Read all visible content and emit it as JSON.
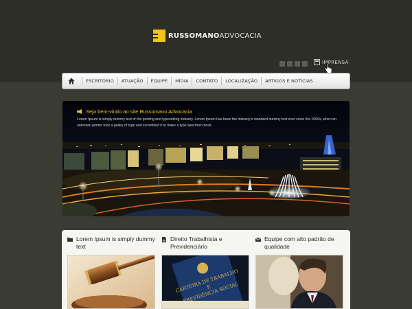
{
  "header": {
    "brand_bold": "RUSSOMANO",
    "brand_light": "ADVOCACIA",
    "social_icons": [
      "facebook-icon",
      "twitter-icon",
      "youtube-icon",
      "rss-icon"
    ],
    "imprensa_label": "IMPRENSA"
  },
  "nav": {
    "home_icon": "home-icon",
    "items": [
      "ESCRITÓRIO",
      "ATUAÇÃO",
      "EQUIPE",
      "MÍDIA",
      "CONTATO",
      "LOCALIZAÇÃO",
      "ARTIGOS E NOTÍCIAS"
    ]
  },
  "hero": {
    "title": "Seja bem-vindo ao site Russomano Advocacia",
    "text": "Lorem Ipsum is simply dummy text of the printing and typesetting industry. Lorem Ipsum has been the industry's standard dummy text ever since the 1500s, when an unknown printer took a galley of type and scrambled it to make a type specimen book."
  },
  "cards": [
    {
      "icon": "folder-icon",
      "title": "Lorem Ipsum is simply dummy text",
      "image": "gavel"
    },
    {
      "icon": "document-icon",
      "title": "Direito Trabalhista e Previdenciário",
      "image": "work-card"
    },
    {
      "icon": "envelope-icon",
      "title": "Equipe com alto padrão de qualidade",
      "image": "lawyer"
    }
  ],
  "work_card_text": {
    "line1": "CARTEIRA DE TRABALHO",
    "line2": "E",
    "line3": "PREVIDÊNCIA SOCIAL"
  },
  "colors": {
    "accent": "#f0c419",
    "header_bg": "#2d2e27",
    "page_bg": "#3a3b33",
    "panel_bg": "#f5f5f2"
  }
}
